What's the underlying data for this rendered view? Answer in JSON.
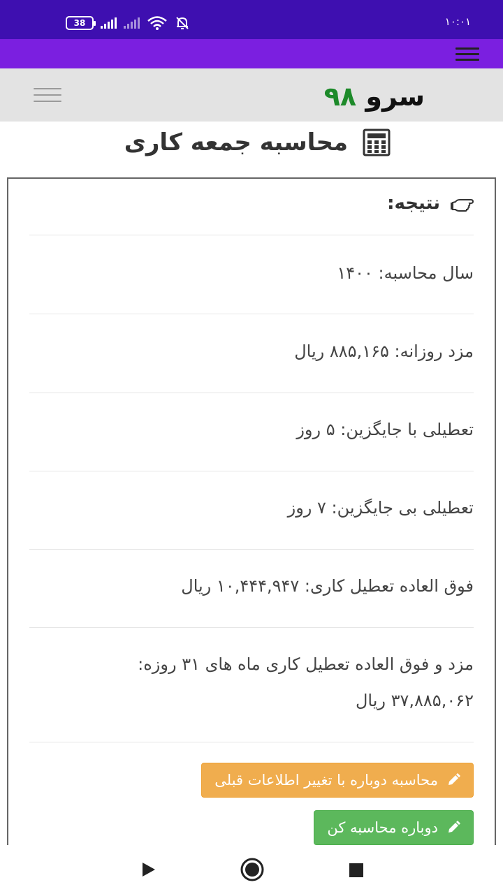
{
  "status_bar": {
    "battery": "38",
    "time": "۱۰:۰۱"
  },
  "header": {
    "brand_name": "سرو",
    "brand_number": "۹۸"
  },
  "page": {
    "title": "محاسبه جمعه کاری",
    "title_icon": "calculator-icon"
  },
  "result": {
    "heading": "نتیجه:",
    "heading_icon": "hand-pointer-icon",
    "rows": [
      "سال محاسبه: ۱۴۰۰",
      "مزد روزانه: ۸۸۵,۱۶۵ ریال",
      "تعطیلی با جایگزین: ۵ روز",
      "تعطیلی بی جایگزین: ۷ روز",
      "فوق العاده تعطیل کاری: ۱۰,۴۴۴,۹۴۷ ریال"
    ],
    "total_label": "مزد و فوق العاده تعطیل کاری ماه های ۳۱ روزه:",
    "total_value": "۳۷,۸۸۵,۰۶۲ ریال"
  },
  "buttons": {
    "recalc_with_previous": "محاسبه دوباره با تغییر اطلاعات قبلی",
    "recalc": "دوباره محاسبه کن"
  },
  "colors": {
    "status_bar": "#3e0fb0",
    "app_bar": "#7b1fe0",
    "brand_green": "#1d8a2a",
    "button_orange": "#f0ad4e",
    "button_green": "#5cb85c"
  }
}
